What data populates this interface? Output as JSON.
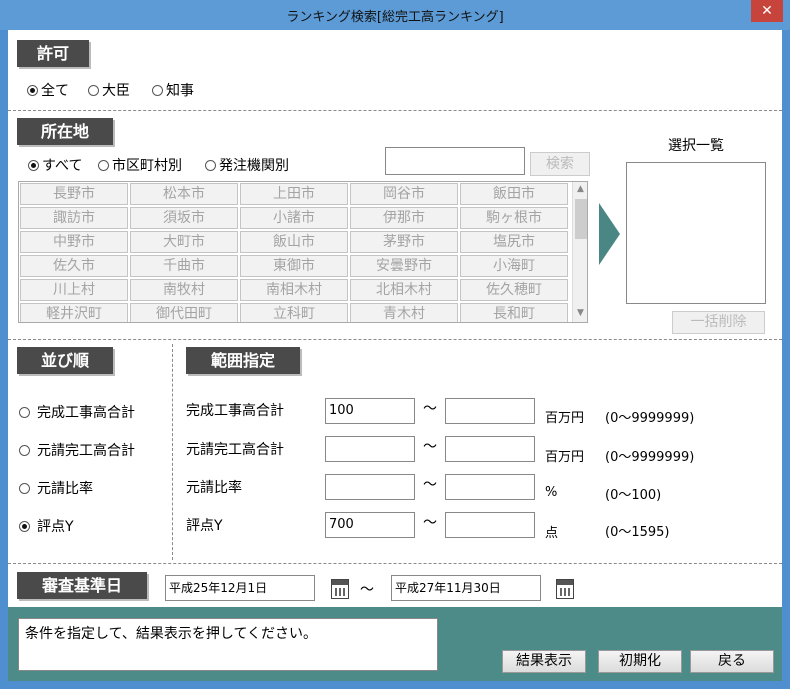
{
  "window": {
    "title": "ランキング検索[総完工高ランキング]",
    "close": "✕"
  },
  "kyoka": {
    "header": "許可",
    "options": [
      "全て",
      "大臣",
      "知事"
    ],
    "selected": 0
  },
  "shozaichi": {
    "header": "所在地",
    "options": [
      "すべて",
      "市区町村別",
      "発注機関別"
    ],
    "selected": 0,
    "search_value": "",
    "search_button": "検索",
    "cities": [
      [
        "長野市",
        "松本市",
        "上田市",
        "岡谷市",
        "飯田市"
      ],
      [
        "諏訪市",
        "須坂市",
        "小諸市",
        "伊那市",
        "駒ヶ根市"
      ],
      [
        "中野市",
        "大町市",
        "飯山市",
        "茅野市",
        "塩尻市"
      ],
      [
        "佐久市",
        "千曲市",
        "東御市",
        "安曇野市",
        "小海町"
      ],
      [
        "川上村",
        "南牧村",
        "南相木村",
        "北相木村",
        "佐久穂町"
      ],
      [
        "軽井沢町",
        "御代田町",
        "立科町",
        "青木村",
        "長和町"
      ]
    ]
  },
  "selection": {
    "title": "選択一覧",
    "clear_button": "一括削除"
  },
  "sort": {
    "header": "並び順",
    "options": [
      "完成工事高合計",
      "元請完工高合計",
      "元請比率",
      "評点Y"
    ],
    "selected": 3
  },
  "range": {
    "header": "範囲指定",
    "rows": [
      {
        "label": "完成工事高合計",
        "from": "100",
        "to": "",
        "unit": "百万円",
        "hint": "(0～9999999)"
      },
      {
        "label": "元請完工高合計",
        "from": "",
        "to": "",
        "unit": "百万円",
        "hint": "(0～9999999)"
      },
      {
        "label": "元請比率",
        "from": "",
        "to": "",
        "unit": "%",
        "hint": "(0～100)"
      },
      {
        "label": "評点Y",
        "from": "700",
        "to": "",
        "unit": "点",
        "hint": "(0～1595)"
      }
    ],
    "tilde": "～"
  },
  "date": {
    "header": "審査基準日",
    "from": "平成25年12月1日",
    "to": "平成27年11月30日",
    "tilde": "～"
  },
  "footer": {
    "message": "条件を指定して、結果表示を押してください。",
    "result_button": "結果表示",
    "reset_button": "初期化",
    "back_button": "戻る"
  }
}
